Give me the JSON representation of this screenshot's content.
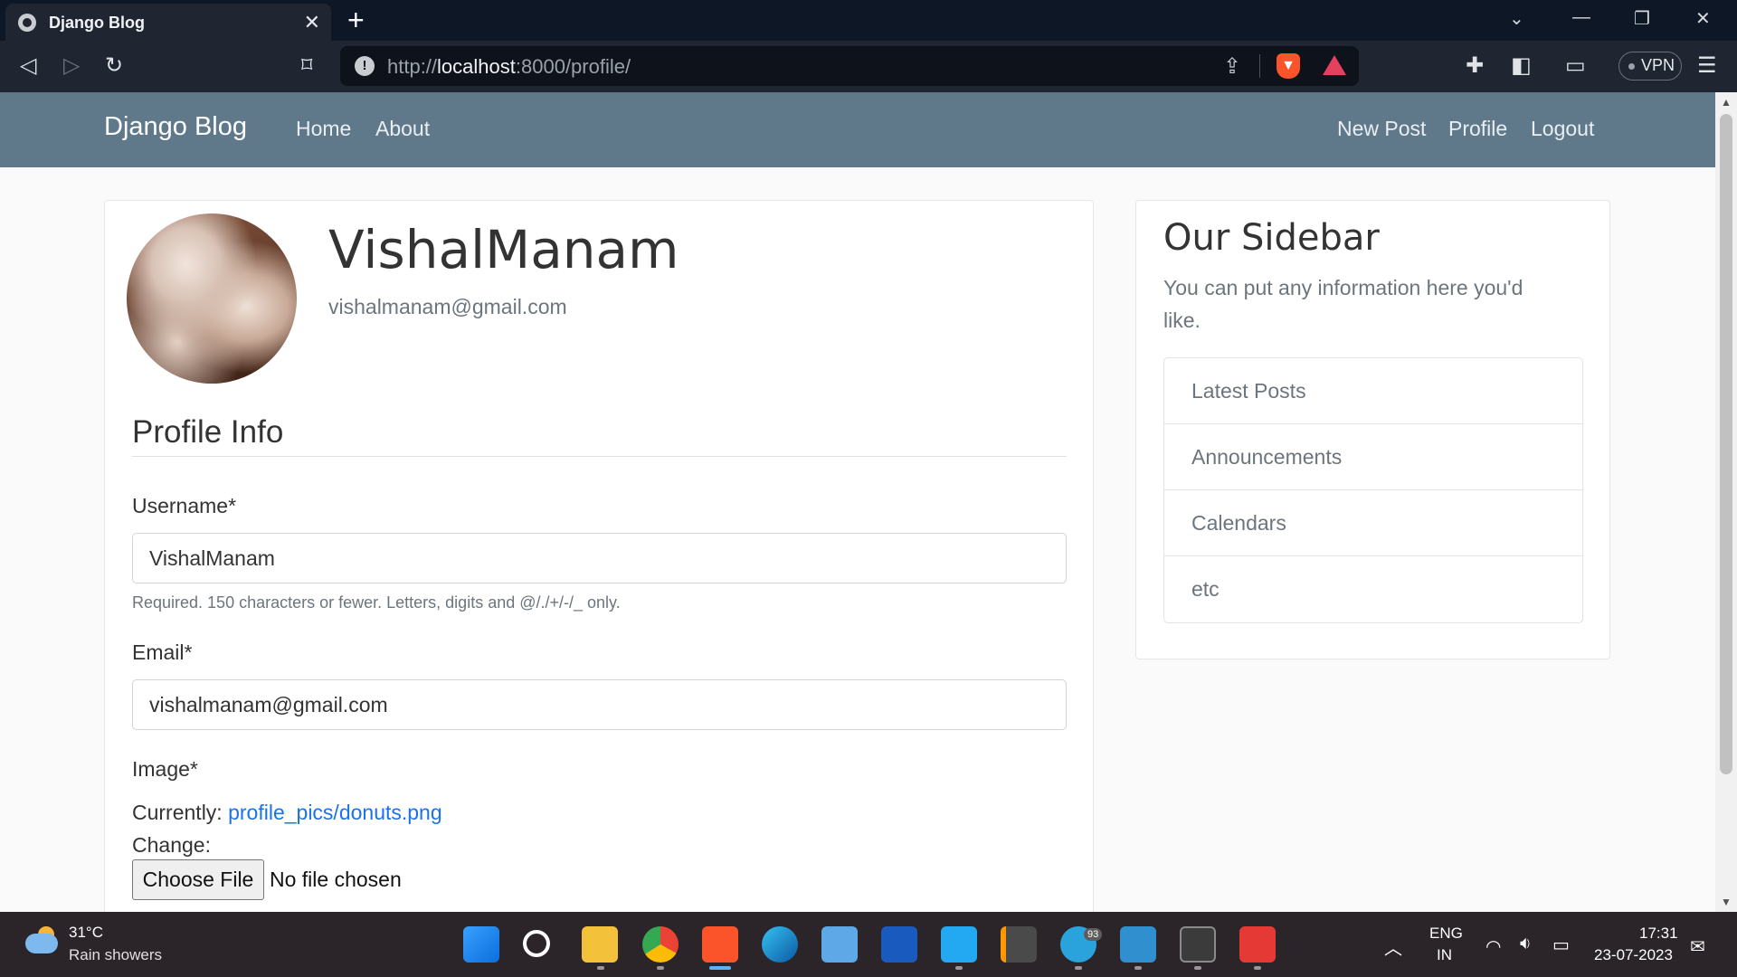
{
  "browser": {
    "tab_title": "Django Blog",
    "url_prefix": "http://",
    "url_host": "localhost",
    "url_rest": ":8000/profile/",
    "vpn_label": "VPN",
    "brand_color": "#fb542b"
  },
  "navbar": {
    "brand": "Django Blog",
    "left_links": [
      "Home",
      "About"
    ],
    "right_links": [
      "New Post",
      "Profile",
      "Logout"
    ],
    "background": "#5f788a"
  },
  "profile": {
    "username": "VishalManam",
    "email": "vishalmanam@gmail.com"
  },
  "form": {
    "legend": "Profile Info",
    "username_label": "Username*",
    "username_value": "VishalManam",
    "username_help": "Required. 150 characters or fewer. Letters, digits and @/./+/-/_ only.",
    "email_label": "Email*",
    "email_value": "vishalmanam@gmail.com",
    "image_label": "Image*",
    "currently_label": "Currently:",
    "currently_link": "profile_pics/donuts.png",
    "change_label": "Change:",
    "choose_file": "Choose File",
    "no_file": "No file chosen"
  },
  "sidebar": {
    "title": "Our Sidebar",
    "text": "You can put any information here you'd like.",
    "items": [
      "Latest Posts",
      "Announcements",
      "Calendars",
      "etc"
    ]
  },
  "taskbar": {
    "temperature": "31°C",
    "weather": "Rain showers",
    "telegram_badge": "93",
    "lang_top": "ENG",
    "lang_bottom": "IN",
    "time": "17:31",
    "date": "23-07-2023"
  }
}
